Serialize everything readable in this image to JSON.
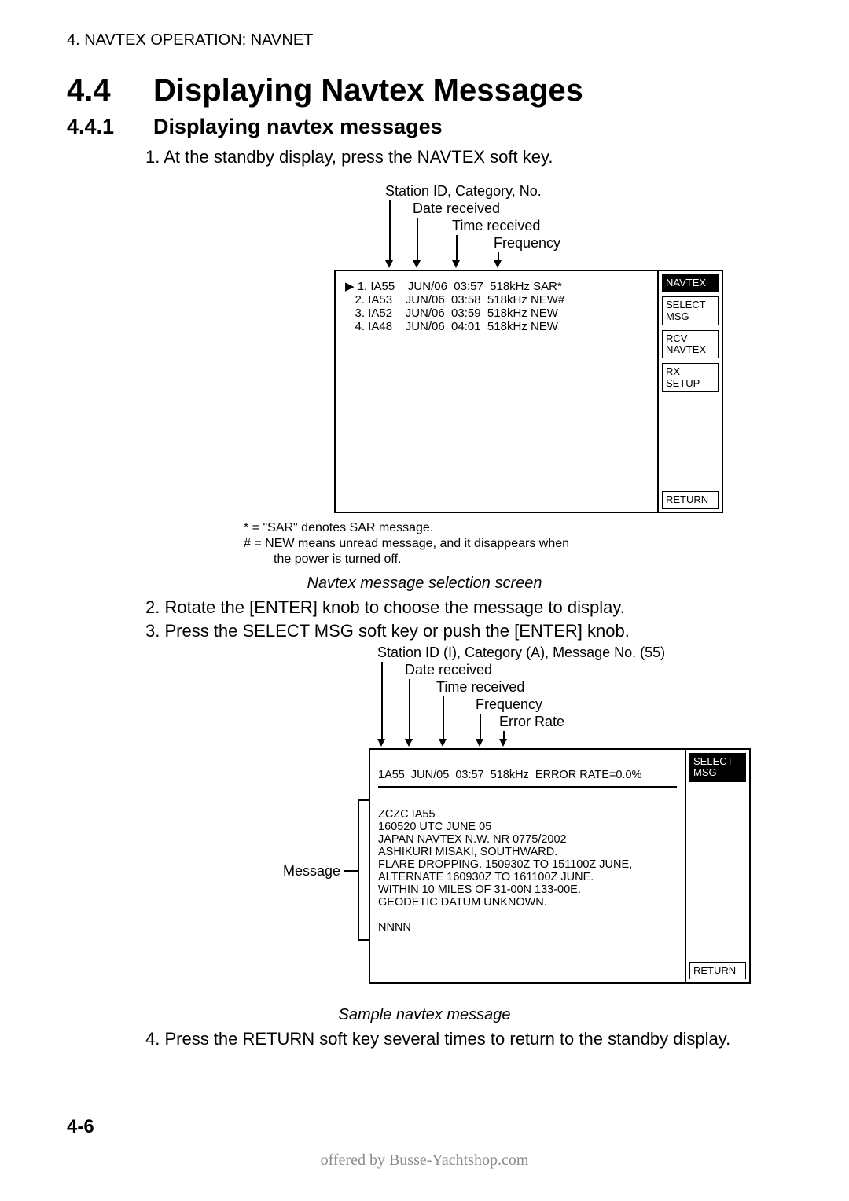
{
  "header": "4. NAVTEX OPERATION: NAVNET",
  "section_num": "4.4",
  "section_title": "Displaying Navtex Messages",
  "subsection_num": "4.4.1",
  "subsection_title": "Displaying navtex messages",
  "steps": {
    "s1": "1.  At the standby display, press the NAVTEX soft key.",
    "s2": "2.  Rotate the [ENTER] knob to choose the message to display.",
    "s3": "3.  Press the SELECT MSG soft key or push the [ENTER] knob.",
    "s4": "4.  Press the RETURN soft key several times to return to the standby display."
  },
  "fig1": {
    "callouts": {
      "c1": "Station ID, Category, No.",
      "c2": "Date received",
      "c3": "Time received",
      "c4": "Frequency"
    },
    "rows": [
      {
        "idx": "1.",
        "id": "IA55",
        "date": "JUN/06",
        "time": "03:57",
        "freq": "518kHz",
        "tag": "SAR*",
        "sel": true
      },
      {
        "idx": "2.",
        "id": "IA53",
        "date": "JUN/06",
        "time": "03:58",
        "freq": "518kHz",
        "tag": "NEW#",
        "sel": false
      },
      {
        "idx": "3.",
        "id": "IA52",
        "date": "JUN/06",
        "time": "03:59",
        "freq": "518kHz",
        "tag": "NEW",
        "sel": false
      },
      {
        "idx": "4.",
        "id": "IA48",
        "date": "JUN/06",
        "time": "04:01",
        "freq": "518kHz",
        "tag": "NEW",
        "sel": false
      }
    ],
    "softkeys": {
      "title": "NAVTEX",
      "k1": "SELECT MSG",
      "k2": "RCV NAVTEX",
      "k3": "RX SETUP",
      "ret": "RETURN"
    },
    "notes": {
      "n1": "* =  \"SAR\" denotes SAR message.",
      "n2a": "# =  NEW means unread message, and it disappears when",
      "n2b": "the power is turned off."
    },
    "caption": "Navtex message selection screen"
  },
  "fig2": {
    "callouts": {
      "c1": "Station ID (I), Category (A), Message No. (55)",
      "c2": "Date received",
      "c3": "Time received",
      "c4": "Frequency",
      "c5": "Error Rate"
    },
    "brace_label": "Message",
    "hdr": "1A55  JUN/05  03:57  518kHz  ERROR RATE=0.0%",
    "body": [
      "ZCZC  IA55",
      "160520 UTC JUNE 05",
      "JAPAN NAVTEX N.W. NR 0775/2002",
      "ASHIKURI MISAKI, SOUTHWARD.",
      "FLARE DROPPING.  150930Z TO 151100Z JUNE,",
      "ALTERNATE 160930Z TO 161100Z JUNE.",
      "WITHIN 10 MILES OF 31-00N 133-00E.",
      "GEODETIC DATUM UNKNOWN.",
      "",
      "NNNN"
    ],
    "softkeys": {
      "title": "SELECT MSG",
      "ret": "RETURN"
    },
    "caption": "Sample navtex message"
  },
  "pagenum": "4-6",
  "footer": "offered by Busse-Yachtshop.com"
}
